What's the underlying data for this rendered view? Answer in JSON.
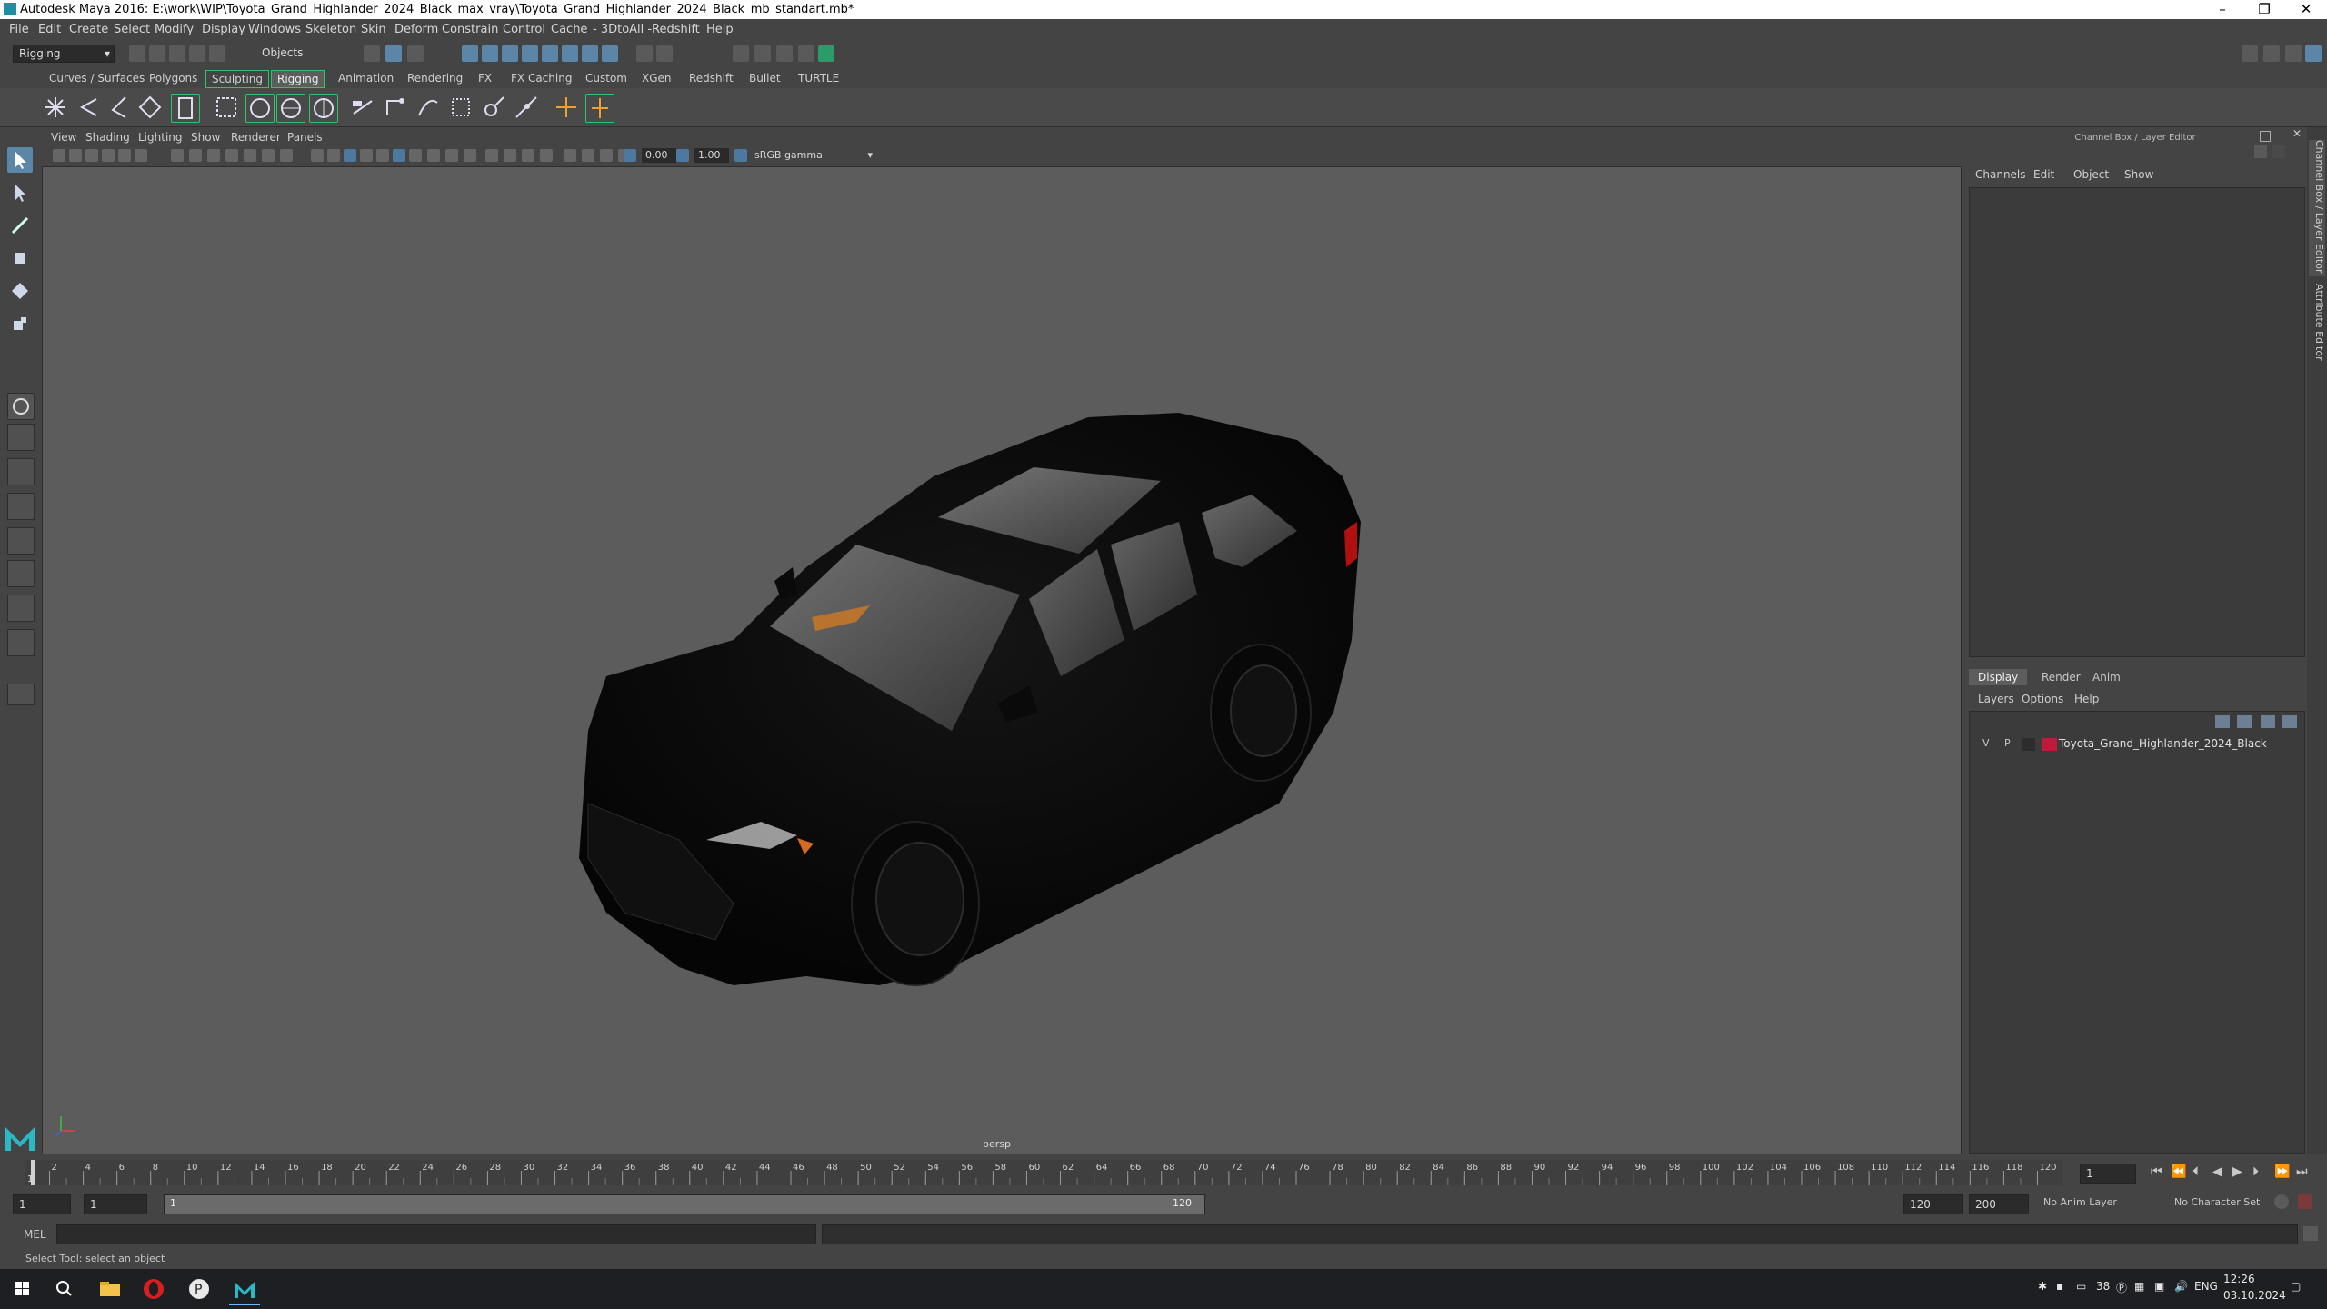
{
  "window": {
    "title": "Autodesk Maya 2016: E:\\work\\WIP\\Toyota_Grand_Highlander_2024_Black_max_vray\\Toyota_Grand_Highlander_2024_Black_mb_standart.mb*",
    "minimize": "–",
    "maximize": "❐",
    "close": "✕"
  },
  "menubar": [
    "File",
    "Edit",
    "Create",
    "Select",
    "Modify",
    "Display",
    "Windows",
    "Skeleton",
    "Skin",
    "Deform",
    "Constrain",
    "Control",
    "Cache",
    "- 3DtoAll -",
    "Redshift",
    "Help"
  ],
  "statusline": {
    "menuset": "Rigging",
    "selection_mode": "Objects"
  },
  "shelf_tabs": [
    {
      "label": "Curves / Surfaces"
    },
    {
      "label": "Polygons"
    },
    {
      "label": "Sculpting"
    },
    {
      "label": "Rigging",
      "active": true
    },
    {
      "label": "Animation"
    },
    {
      "label": "Rendering"
    },
    {
      "label": "FX"
    },
    {
      "label": "FX Caching"
    },
    {
      "label": "Custom"
    },
    {
      "label": "XGen"
    },
    {
      "label": "Redshift"
    },
    {
      "label": "Bullet"
    },
    {
      "label": "TURTLE"
    }
  ],
  "viewport": {
    "menus": [
      "View",
      "Shading",
      "Lighting",
      "Show",
      "Renderer",
      "Panels"
    ],
    "near_value": "0.00",
    "far_value": "1.00",
    "color_space": "sRGB gamma",
    "camera_label": "persp"
  },
  "channel_box": {
    "title": "Channel Box / Layer Editor",
    "menus": [
      "Channels",
      "Edit",
      "Object",
      "Show"
    ]
  },
  "side_tabs": [
    "Channel Box / Layer Editor",
    "Attribute Editor"
  ],
  "layer_editor": {
    "tabs": [
      "Display",
      "Render",
      "Anim"
    ],
    "active_tab": "Display",
    "menus": [
      "Layers",
      "Options",
      "Help"
    ],
    "layers": [
      {
        "visible": "V",
        "playback": "P",
        "color": "#c2183c",
        "name": "Toyota_Grand_Highlander_2024_Black"
      }
    ]
  },
  "timeline": {
    "ticks": [
      "2",
      "4",
      "6",
      "8",
      "10",
      "12",
      "14",
      "16",
      "18",
      "20",
      "22",
      "24",
      "26",
      "28",
      "30",
      "32",
      "34",
      "36",
      "38",
      "40",
      "42",
      "44",
      "46",
      "48",
      "50",
      "52",
      "54",
      "56",
      "58",
      "60",
      "62",
      "64",
      "66",
      "68",
      "70",
      "72",
      "74",
      "76",
      "78",
      "80",
      "82",
      "84",
      "86",
      "88",
      "90",
      "92",
      "94",
      "96",
      "98",
      "100",
      "102",
      "104",
      "106",
      "108",
      "110",
      "112",
      "114",
      "116",
      "118",
      "120"
    ],
    "first_tick": "1",
    "current_frame": "1"
  },
  "range": {
    "start": "1",
    "playback_start": "1",
    "range_left": "1",
    "range_right": "120",
    "playback_end": "120",
    "end": "200",
    "anim_layer": "No Anim Layer",
    "character_set": "No Character Set"
  },
  "command_line": {
    "label": "MEL"
  },
  "help_line": "Select Tool: select an object",
  "taskbar": {
    "tray_lang": "ENG",
    "tray_temp": "38",
    "time": "12:26",
    "date": "03.10.2024"
  },
  "colors": {
    "active_tab_border": "#2ec46c",
    "highlight_blue": "#5b86a8",
    "layer_color": "#c2183c"
  }
}
